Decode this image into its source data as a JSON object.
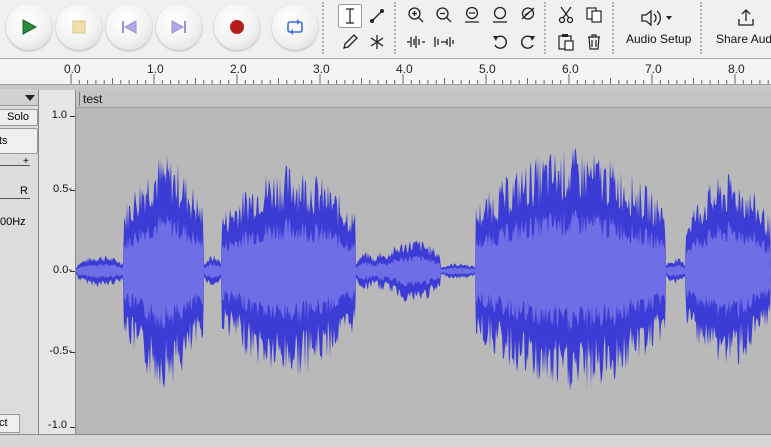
{
  "toolbar": {
    "play_icon": "play-icon",
    "stop_icon": "stop-icon",
    "skip_start_icon": "skip-to-start-icon",
    "skip_end_icon": "skip-to-end-icon",
    "record_icon": "record-icon",
    "loop_icon": "loop-icon",
    "audio_setup_label": "Audio Setup",
    "share_audio_label": "Share Aud"
  },
  "colors": {
    "play": "#2e8b3a",
    "stop": "#e8d89a",
    "skip": "#9b8fd6",
    "record": "#b51c1c",
    "loop": "#3a6fd8",
    "waveform": "#3b3bd6",
    "waveform_rms": "#6e6ee6",
    "background": "#b9b9b9"
  },
  "ruler": {
    "ticks": [
      "0.0",
      "1.0",
      "2.0",
      "3.0",
      "4.0",
      "5.0",
      "6.0",
      "7.0",
      "8.0"
    ]
  },
  "track": {
    "name": "test",
    "solo_label": "Solo",
    "effects_label": "ts",
    "gain_plus": "+",
    "pan_right": "R",
    "rate_label": "00Hz",
    "select_label": "ct"
  },
  "vertical_scale": {
    "labels": [
      "1.0",
      "0.5-",
      "0.0-",
      "-0.5-",
      "-1.0"
    ]
  }
}
